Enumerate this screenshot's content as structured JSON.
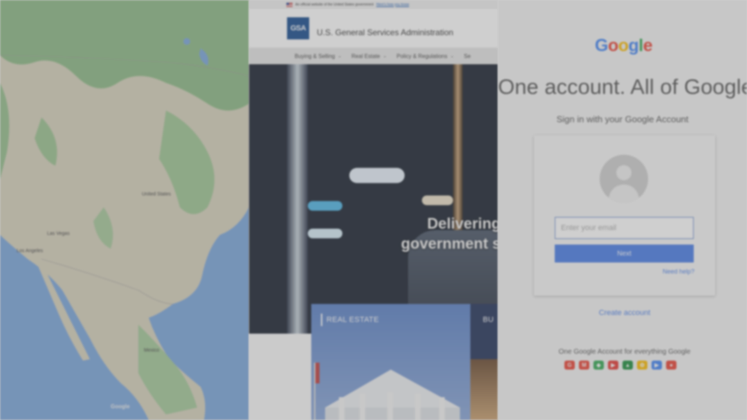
{
  "map": {
    "country_label": "United States",
    "city_label_1": "Las Vegas",
    "city_label_2": "Mexico",
    "city_label_3": "Los Angeles",
    "logo_text": "Google"
  },
  "gsa": {
    "banner_text": "An official website of the United States government",
    "banner_link": "Here's how you know",
    "logo_text": "GSA",
    "title": "U.S. General Services Administration",
    "nav": [
      {
        "label": "Buying & Selling"
      },
      {
        "label": "Real Estate"
      },
      {
        "label": "Policy & Regulations"
      },
      {
        "label": "Se"
      }
    ],
    "hero_line1": "Delivering",
    "hero_line2": "government s",
    "card1_label": "REAL ESTATE",
    "card2_label": "BU"
  },
  "google": {
    "logo": [
      "G",
      "o",
      "o",
      "g",
      "l",
      "e"
    ],
    "logo_colors": [
      "#4285f4",
      "#ea4335",
      "#fbbc05",
      "#4285f4",
      "#34a853",
      "#ea4335"
    ],
    "headline": "One account. All of Google.",
    "subtitle": "Sign in with your Google Account",
    "email_placeholder": "Enter your email",
    "next_label": "Next",
    "help_label": "Need help?",
    "create_account": "Create account",
    "footer": "One Google Account for everything Google",
    "app_icons": [
      {
        "name": "google-icon",
        "glyph": "G",
        "color": "#ea4335"
      },
      {
        "name": "gmail-icon",
        "glyph": "M",
        "color": "#ea4335"
      },
      {
        "name": "maps-icon",
        "glyph": "◆",
        "color": "#34a853"
      },
      {
        "name": "youtube-icon",
        "glyph": "▶",
        "color": "#e53935"
      },
      {
        "name": "drive-icon",
        "glyph": "▲",
        "color": "#1e8e3e"
      },
      {
        "name": "photos-icon",
        "glyph": "✿",
        "color": "#fbbc05"
      },
      {
        "name": "play-icon",
        "glyph": "▶",
        "color": "#4285f4"
      },
      {
        "name": "chrome-icon",
        "glyph": "●",
        "color": "#ea4335"
      }
    ]
  }
}
